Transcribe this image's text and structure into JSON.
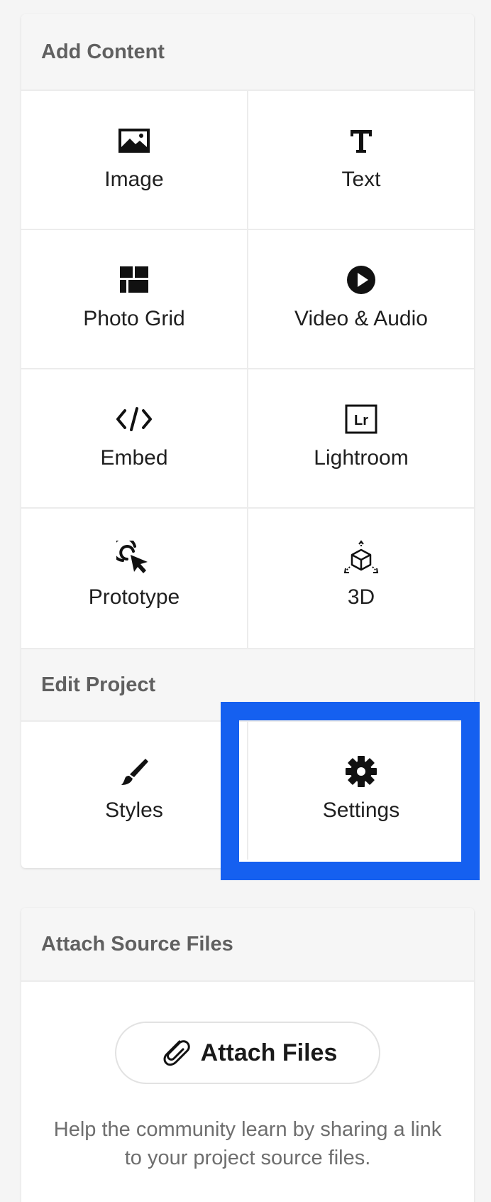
{
  "add_content": {
    "title": "Add Content",
    "items": [
      {
        "label": "Image",
        "icon": "image-icon"
      },
      {
        "label": "Text",
        "icon": "text-icon"
      },
      {
        "label": "Photo Grid",
        "icon": "photo-grid-icon"
      },
      {
        "label": "Video & Audio",
        "icon": "play-icon"
      },
      {
        "label": "Embed",
        "icon": "code-icon"
      },
      {
        "label": "Lightroom",
        "icon": "lightroom-icon",
        "badge": "Lr"
      },
      {
        "label": "Prototype",
        "icon": "prototype-cursor-icon"
      },
      {
        "label": "3D",
        "icon": "cube-3d-icon"
      }
    ]
  },
  "edit_project": {
    "title": "Edit Project",
    "items": [
      {
        "label": "Styles",
        "icon": "brush-icon"
      },
      {
        "label": "Settings",
        "icon": "gear-icon"
      }
    ]
  },
  "attach": {
    "title": "Attach Source Files",
    "button_label": "Attach Files",
    "button_icon": "paperclip-icon",
    "help_text": "Help the community learn by sharing a link to your project source files."
  },
  "colors": {
    "highlight": "#1560f0",
    "header_bg": "#f6f6f6",
    "text": "#1f1f1f",
    "muted": "#6e6e6e"
  }
}
